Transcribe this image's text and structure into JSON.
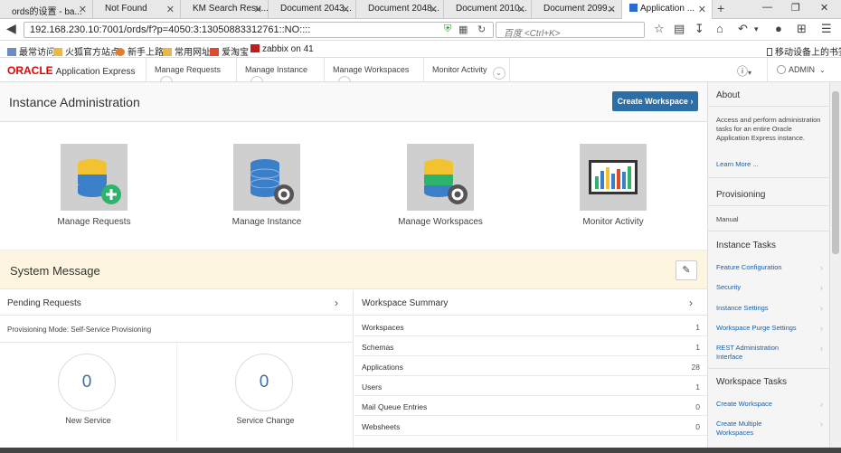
{
  "browser": {
    "tabs": [
      {
        "title": "ords的设置 - ba..."
      },
      {
        "title": "Not Found"
      },
      {
        "title": "KM Search Resu..."
      },
      {
        "title": "Document 2043..."
      },
      {
        "title": "Document 2048..."
      },
      {
        "title": "Document 2010..."
      },
      {
        "title": "Document 2099..."
      },
      {
        "title": "Application ..."
      }
    ],
    "new_tab": "+",
    "url": "192.168.230.10:7001/ords/f?p=4050:3:13050883312761::NO::::",
    "search_placeholder": "百度 <Ctrl+K>",
    "bookmarks": [
      {
        "label": "最常访问"
      },
      {
        "label": "火狐官方站点"
      },
      {
        "label": "新手上路"
      },
      {
        "label": "常用网址"
      },
      {
        "label": "爱淘宝"
      },
      {
        "label": "zabbix on 41"
      }
    ],
    "mobile_bookmarks": "移动设备上的书签"
  },
  "apex": {
    "logo": "ORACLE",
    "product": "Application Express",
    "menus": [
      {
        "label": "Manage Requests"
      },
      {
        "label": "Manage Instance"
      },
      {
        "label": "Manage Workspaces"
      },
      {
        "label": "Monitor Activity"
      }
    ],
    "user": "ADMIN"
  },
  "main": {
    "title": "Instance Administration",
    "create_button": "Create Workspace",
    "tiles": [
      {
        "label": "Manage Requests"
      },
      {
        "label": "Manage Instance"
      },
      {
        "label": "Manage Workspaces"
      },
      {
        "label": "Monitor Activity"
      }
    ],
    "system_message": "System Message",
    "pending": {
      "title": "Pending Requests",
      "mode": "Provisioning Mode: Self-Service Provisioning",
      "stats": [
        {
          "value": "0",
          "label": "New Service"
        },
        {
          "value": "0",
          "label": "Service Change"
        }
      ]
    },
    "workspace_summary": {
      "title": "Workspace Summary",
      "rows": [
        {
          "label": "Workspaces",
          "value": "1"
        },
        {
          "label": "Schemas",
          "value": "1"
        },
        {
          "label": "Applications",
          "value": "28"
        },
        {
          "label": "Users",
          "value": "1"
        },
        {
          "label": "Mail Queue Entries",
          "value": "0"
        },
        {
          "label": "Websheets",
          "value": "0"
        }
      ]
    }
  },
  "sidebar": {
    "about_title": "About",
    "about_text": "Access and perform administration tasks for an entire Oracle Application Express instance.",
    "learn_more": "Learn More ...",
    "provisioning_title": "Provisioning",
    "provisioning_value": "Manual",
    "instance_tasks_title": "Instance Tasks",
    "instance_tasks": [
      {
        "label": "Feature Configuration"
      },
      {
        "label": "Security"
      },
      {
        "label": "Instance Settings"
      },
      {
        "label": "Workspace Purge Settings"
      },
      {
        "label": "REST Administration Interface"
      }
    ],
    "workspace_tasks_title": "Workspace Tasks",
    "workspace_tasks": [
      {
        "label": "Create Workspace"
      },
      {
        "label": "Create Multiple Workspaces"
      }
    ]
  }
}
